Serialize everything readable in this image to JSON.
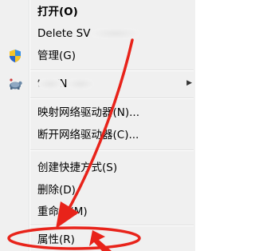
{
  "menu": {
    "items": [
      {
        "label": "打开(O)",
        "bold": true
      },
      {
        "label": "Delete SV         ers"
      },
      {
        "label": "管理(G)",
        "icon": "shield-icon"
      },
      {
        "label": "        t       SVN",
        "icon": "tortoise-svn-icon",
        "submenu": true
      },
      {
        "label": "映射网络驱动器(N)..."
      },
      {
        "label": "断开网络驱动器(C)..."
      },
      {
        "label": "创建快捷方式(S)"
      },
      {
        "label": "删除(D)"
      },
      {
        "label": "重命名(M)"
      },
      {
        "label": "属性(R)"
      }
    ],
    "submenu_arrow": "▶"
  },
  "annotation": {
    "color": "#e8231a"
  }
}
